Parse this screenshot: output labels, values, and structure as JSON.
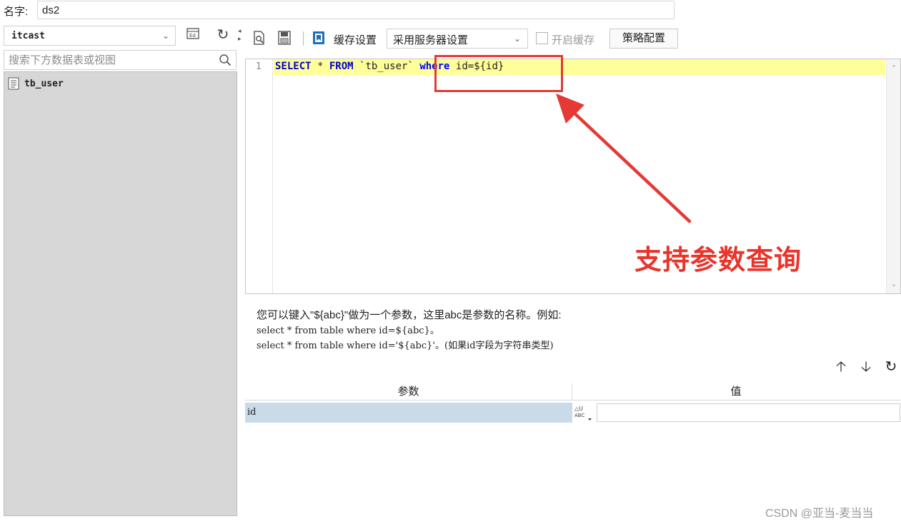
{
  "name_row": {
    "label": "名字:",
    "value": "ds2"
  },
  "left_panel": {
    "connection": "itcast",
    "search_placeholder": "搜索下方数据表或视图",
    "tables": [
      {
        "name": "tb_user"
      }
    ]
  },
  "toolbar": {
    "cache_label": "缓存设置",
    "cache_option": "采用服务器设置",
    "enable_cache_label": "开启缓存",
    "enable_cache_checked": false,
    "strategy_button": "策略配置"
  },
  "editor": {
    "line_number": "1",
    "sql_keyword_select": "SELECT",
    "sql_star": " * ",
    "sql_keyword_from": "FROM",
    "sql_table": " `tb_user` ",
    "sql_keyword_where": "where",
    "sql_condition": " id=${id}"
  },
  "annotation": {
    "text": "支持参数查询",
    "color": "#e8352c"
  },
  "help": {
    "line1": "您可以键入\"${abc}\"做为一个参数，这里abc是参数的名称。例如:",
    "line2": "select * from table where id=${abc}。",
    "line3": "select * from table where id='${abc}'。(如果id字段为字符串类型)"
  },
  "params": {
    "header_name": "参数",
    "header_value": "值",
    "rows": [
      {
        "name": "id",
        "value": ""
      }
    ]
  },
  "watermark": "CSDN @亚当-麦当当"
}
